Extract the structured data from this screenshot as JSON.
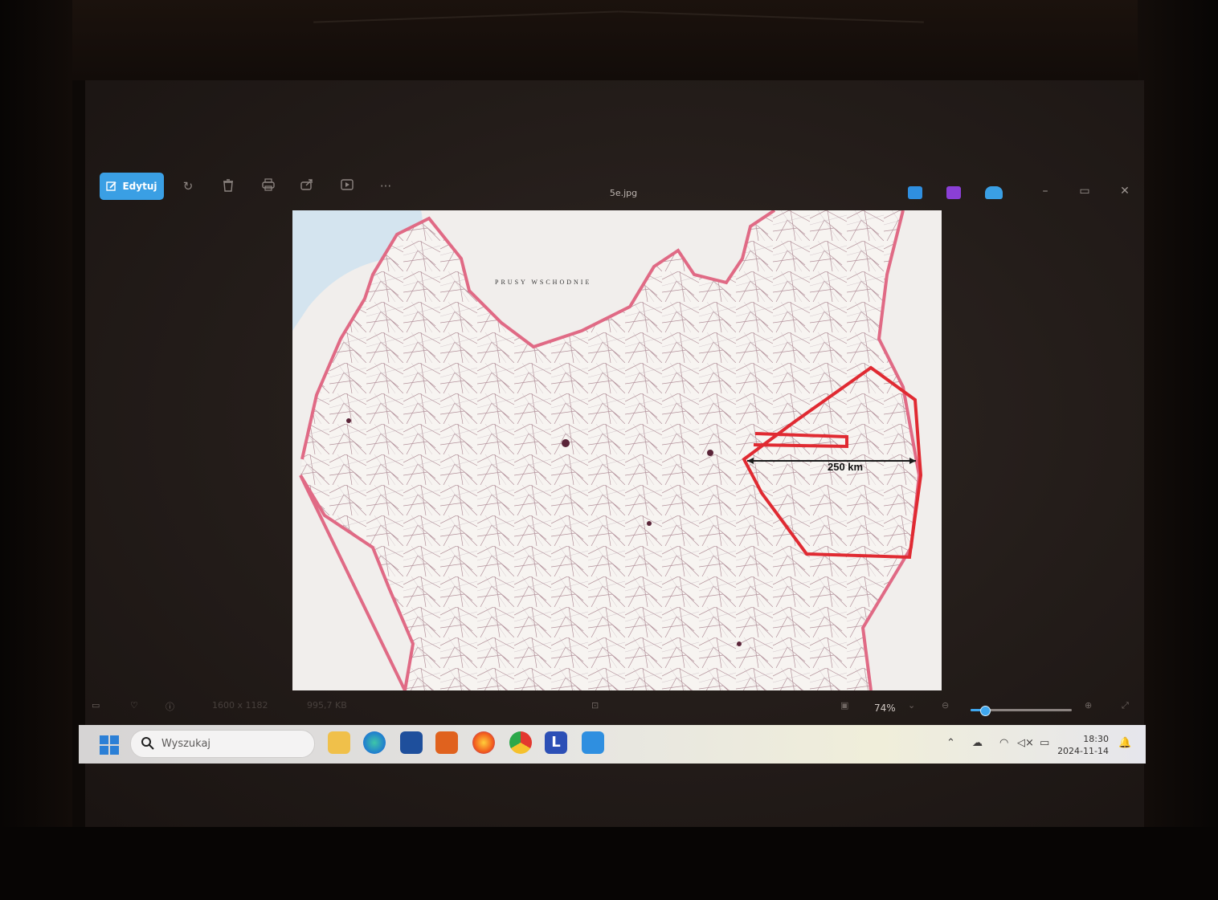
{
  "photos_app": {
    "toolbar": {
      "edit_label": "Edytuj"
    },
    "title": "5e.jpg",
    "image": {
      "description_label": "250 km"
    },
    "status": {
      "dimensions": "1600 x 1182",
      "file_size": "995,7 KB",
      "zoom": "74%",
      "zoom_fraction": 0.14
    }
  },
  "map_labels": {
    "region": "PRUSY WSCHODNIE",
    "scale": "250 km"
  },
  "taskbar": {
    "search_placeholder": "Wyszukaj",
    "apps": [
      "file-explorer",
      "edge",
      "microsoft-store",
      "app-orange",
      "firefox",
      "chrome",
      "app-l",
      "photos"
    ],
    "app_l_letter": "L",
    "time": "18:30",
    "date": "2024-11-14"
  },
  "colors": {
    "accent": "#3a9fe4",
    "border_red": "#e02a32"
  }
}
